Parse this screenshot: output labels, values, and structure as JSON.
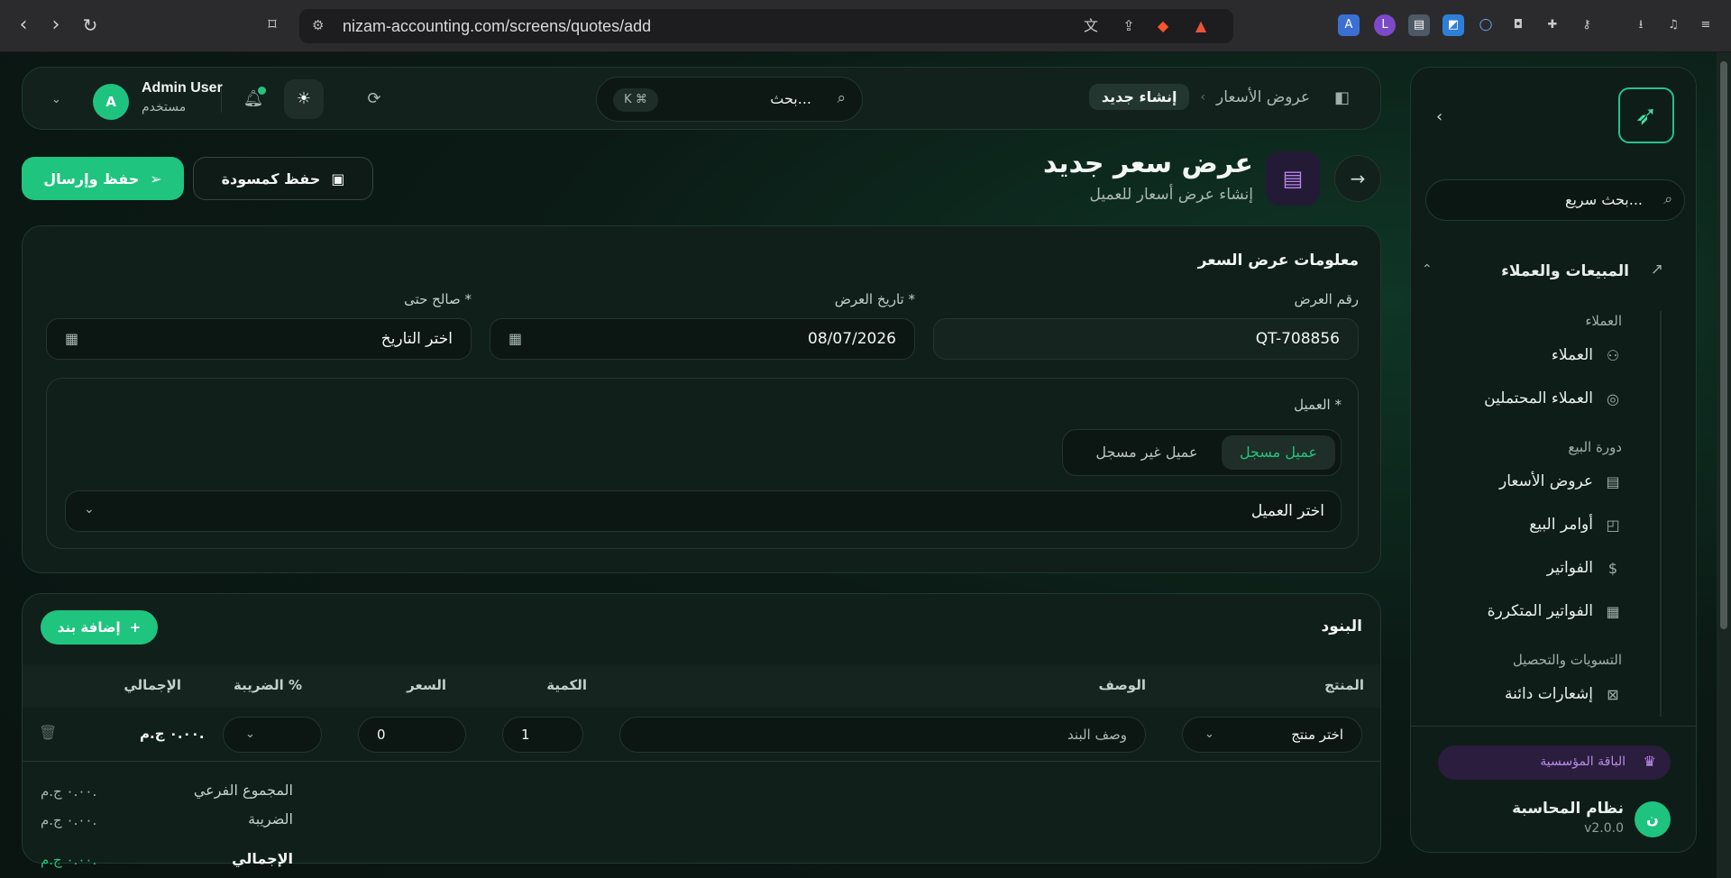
{
  "browser": {
    "url": "nizam-accounting.com/screens/quotes/add"
  },
  "sidebar": {
    "search_placeholder": "بحث سريع...",
    "group": "المبيعات والعملاء",
    "sections": {
      "clients": "العملاء",
      "sales_cycle": "دورة البيع",
      "settlements": "التسويات والتحصيل"
    },
    "items": {
      "clients": "العملاء",
      "leads": "العملاء المحتملين",
      "quotes": "عروض الأسعار",
      "sales_orders": "أوامر البيع",
      "invoices": "الفواتير",
      "recurring_invoices": "الفواتير المتكررة",
      "credit_notes": "إشعارات دائنة"
    },
    "plan": "الباقة المؤسسية",
    "org": {
      "avatar": "ن",
      "name": "نظام المحاسبة",
      "version": "v2.0.0"
    }
  },
  "topbar": {
    "breadcrumb": {
      "parent": "عروض الأسعار",
      "current": "إنشاء جديد"
    },
    "search_placeholder": "بحث...",
    "search_shortcut": "K ⌘",
    "user": {
      "avatar": "A",
      "name": "Admin User",
      "role": "مستخدم"
    }
  },
  "page": {
    "title": "عرض سعر جديد",
    "subtitle": "إنشاء عرض أسعار للعميل",
    "save_send": "حفظ وإرسال",
    "save_draft": "حفظ كمسودة"
  },
  "quote_info": {
    "title": "معلومات عرض السعر",
    "number_label": "رقم العرض",
    "number_value": "QT-708856",
    "date_label": "تاريخ العرض *",
    "date_value": "08/07/2026",
    "valid_label": "صالح حتى *",
    "valid_placeholder": "اختر التاريخ",
    "client_label": "العميل *",
    "client_type_registered": "عميل مسجل",
    "client_type_unregistered": "عميل غير مسجل",
    "client_select_placeholder": "اختر العميل"
  },
  "items": {
    "title": "البنود",
    "add_button": "إضافة بند",
    "columns": {
      "product": "المنتج",
      "description": "الوصف",
      "quantity": "الكمية",
      "price": "السعر",
      "tax": "الضريبة %",
      "total": "الإجمالي"
    },
    "row": {
      "product_placeholder": "اختر منتج",
      "description_placeholder": "وصف البند",
      "quantity": "1",
      "price": "0",
      "total": "٠.٠٠ ج.م."
    },
    "summary": {
      "subtotal_label": "المجموع الفرعي",
      "subtotal_value": "٠.٠٠ ج.م.",
      "tax_label": "الضريبة",
      "tax_value": "٠.٠٠ ج.م.",
      "total_label": "الإجمالي",
      "total_value": "٠.٠٠ ج.م."
    }
  }
}
